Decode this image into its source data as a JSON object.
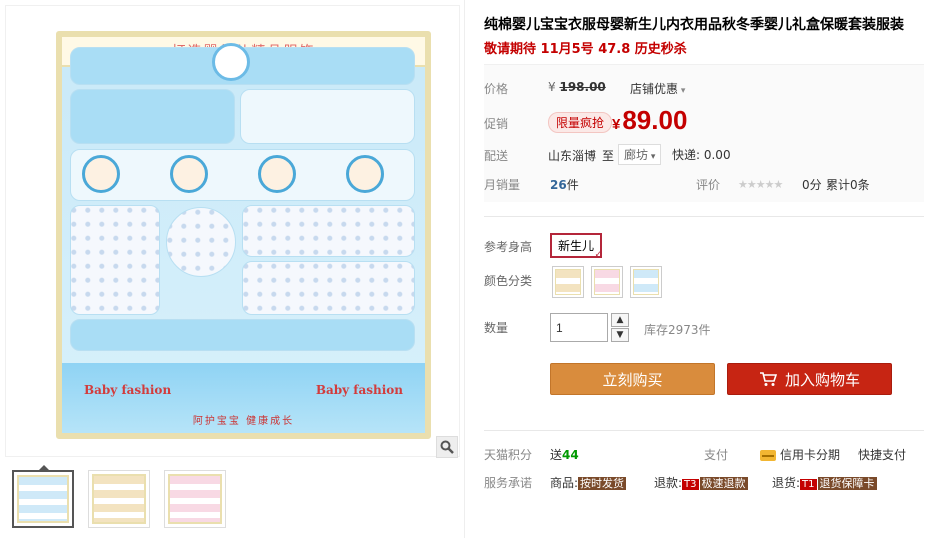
{
  "gallery": {
    "box_header": "打造婴幼儿精品服饰",
    "brand_left": "Baby fashion",
    "brand_right": "Baby fashion",
    "slogan": "阿护宝宝    健康成长",
    "zoom_icon": "magnifier-icon",
    "thumbnails": [
      "thumb-1",
      "thumb-2",
      "thumb-3"
    ]
  },
  "product": {
    "title": "纯棉婴儿宝宝衣服母婴新生儿内衣用品秋冬季婴儿礼盒保暖套装服装",
    "subtitle": "敬请期待 11月5号 47.8 历史秒杀"
  },
  "price": {
    "label": "价格",
    "currency": "¥",
    "original": "198.00",
    "store_promo": "店铺优惠",
    "promo_label": "促销",
    "promo_badge": "限量疯抢",
    "sale_price": "89.00"
  },
  "shipping": {
    "label": "配送",
    "from": "山东淄博",
    "to_word": "至",
    "destination": "廊坊",
    "express": "快递: 0.00"
  },
  "sales": {
    "label": "月销量",
    "count": "26",
    "unit": "件",
    "rating_label": "评价",
    "stars": "★★★★★",
    "score": "0分",
    "review_count": "累计0条"
  },
  "options": {
    "size_label": "参考身高",
    "size_value": "新生儿",
    "color_label": "颜色分类",
    "qty_label": "数量",
    "qty_value": "1",
    "stock": "库存2973件"
  },
  "buttons": {
    "buy_now": "立刻购买",
    "add_to_cart": "加入购物车"
  },
  "extras": {
    "points_label": "天猫积分",
    "points_prefix": "送",
    "points_value": "44",
    "pay_label": "支付",
    "credit": "信用卡分期",
    "quick_pay": "快捷支付",
    "promise_label": "服务承诺",
    "goods_prefix": "商品:",
    "goods_tag": "按时发货",
    "refund_prefix": "退款:",
    "refund_code": "T3",
    "refund_tag": "极速退款",
    "return_prefix": "退货:",
    "return_code": "T1",
    "return_tag": "退货保障卡"
  },
  "colors": {
    "price_red": "#c40000",
    "buy_orange": "#d98c3d",
    "cart_red": "#c72513"
  }
}
